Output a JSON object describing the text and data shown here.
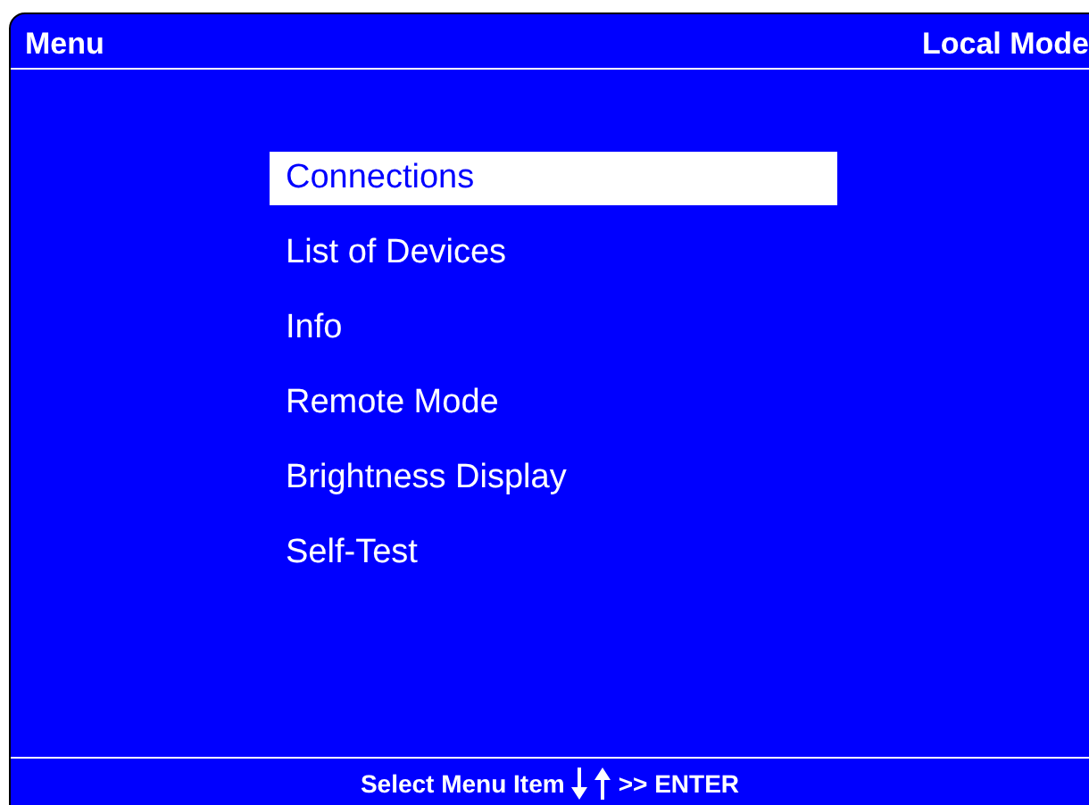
{
  "header": {
    "title": "Menu",
    "mode": "Local Mode"
  },
  "menu": [
    {
      "label": "Connections",
      "selected": true
    },
    {
      "label": "List of Devices",
      "selected": false
    },
    {
      "label": "Info",
      "selected": false
    },
    {
      "label": "Remote Mode",
      "selected": false
    },
    {
      "label": "Brightness Display",
      "selected": false
    },
    {
      "label": "Self-Test",
      "selected": false
    }
  ],
  "footer": {
    "hint": "Select Menu Item",
    "action": ">> ENTER"
  }
}
